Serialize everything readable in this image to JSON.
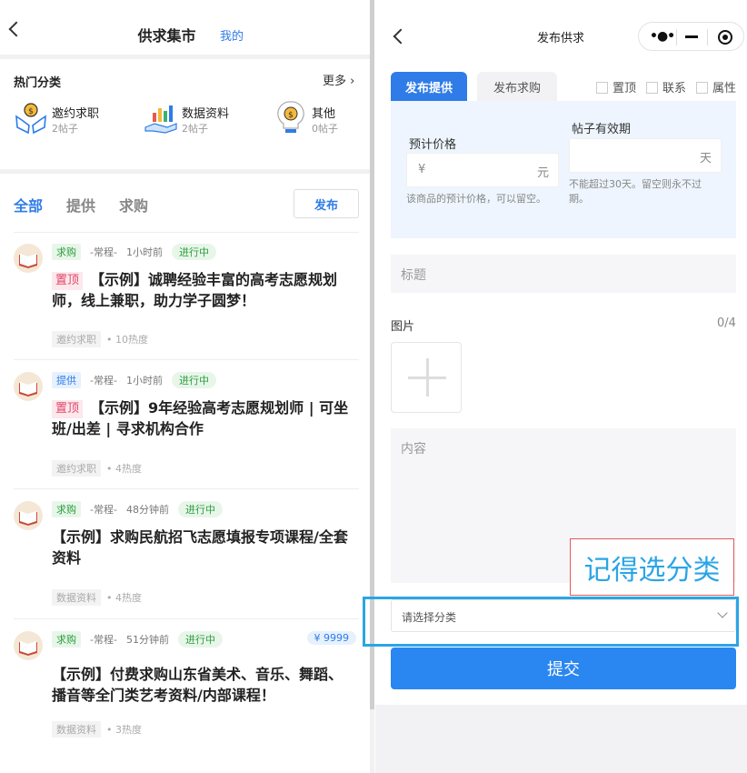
{
  "left": {
    "header": {
      "title": "供求集市",
      "mine_link": "我的"
    },
    "hot": {
      "title": "热门分类",
      "more": "更多 ›",
      "categories": [
        {
          "name": "邀约求职",
          "count": "2帖子",
          "icon": "hands-coin-icon"
        },
        {
          "name": "数据资料",
          "count": "2帖子",
          "icon": "chart-hand-icon"
        },
        {
          "name": "其他",
          "count": "0帖子",
          "icon": "bulb-coin-icon"
        }
      ]
    },
    "tabs": [
      "全部",
      "提供",
      "求购"
    ],
    "publish_label": "发布",
    "posts": [
      {
        "type": "求购",
        "kind": "-常程-",
        "time": "1小时前",
        "status": "进行中",
        "pinned": "置顶",
        "title": "【示例】诚聘经验丰富的高考志愿规划师，线上兼职，助力学子圆梦！",
        "category": "邀约求职",
        "heat": "• 10热度",
        "price": ""
      },
      {
        "type": "提供",
        "kind": "-常程-",
        "time": "1小时前",
        "status": "进行中",
        "pinned": "置顶",
        "title": "【示例】9年经验高考志愿规划师 | 可坐班/出差 | 寻求机构合作",
        "category": "邀约求职",
        "heat": "• 4热度",
        "price": ""
      },
      {
        "type": "求购",
        "kind": "-常程-",
        "time": "48分钟前",
        "status": "进行中",
        "pinned": "",
        "title": "【示例】求购民航招飞志愿填报专项课程/全套资料",
        "category": "数据资料",
        "heat": "• 4热度",
        "price": ""
      },
      {
        "type": "求购",
        "kind": "-常程-",
        "time": "51分钟前",
        "status": "进行中",
        "pinned": "",
        "title": "【示例】付费求购山东省美术、音乐、舞蹈、播音等全门类艺考资料/内部课程！",
        "category": "数据资料",
        "heat": "• 3热度",
        "price": "¥ 9999"
      }
    ]
  },
  "right": {
    "header": {
      "title": "发布供求"
    },
    "tabs": {
      "offer": "发布提供",
      "buy": "发布求购"
    },
    "checks": [
      "置顶",
      "联系",
      "属性"
    ],
    "price": {
      "label": "预计价格",
      "prefix": "¥",
      "suffix": "元",
      "hint": "该商品的预计价格，可以留空。"
    },
    "validity": {
      "label": "帖子有效期",
      "suffix": "天",
      "hint": "不能超过30天。留空则永不过期。"
    },
    "title_placeholder": "标题",
    "image": {
      "label": "图片",
      "count": "0/4"
    },
    "content_placeholder": "内容",
    "annotation": "记得选分类",
    "category_placeholder": "请选择分类",
    "submit": "提交"
  },
  "colors": {
    "accent": "#2f7ce8",
    "highlight": "#2aa5e6",
    "annotation_border": "#e15a5a"
  }
}
